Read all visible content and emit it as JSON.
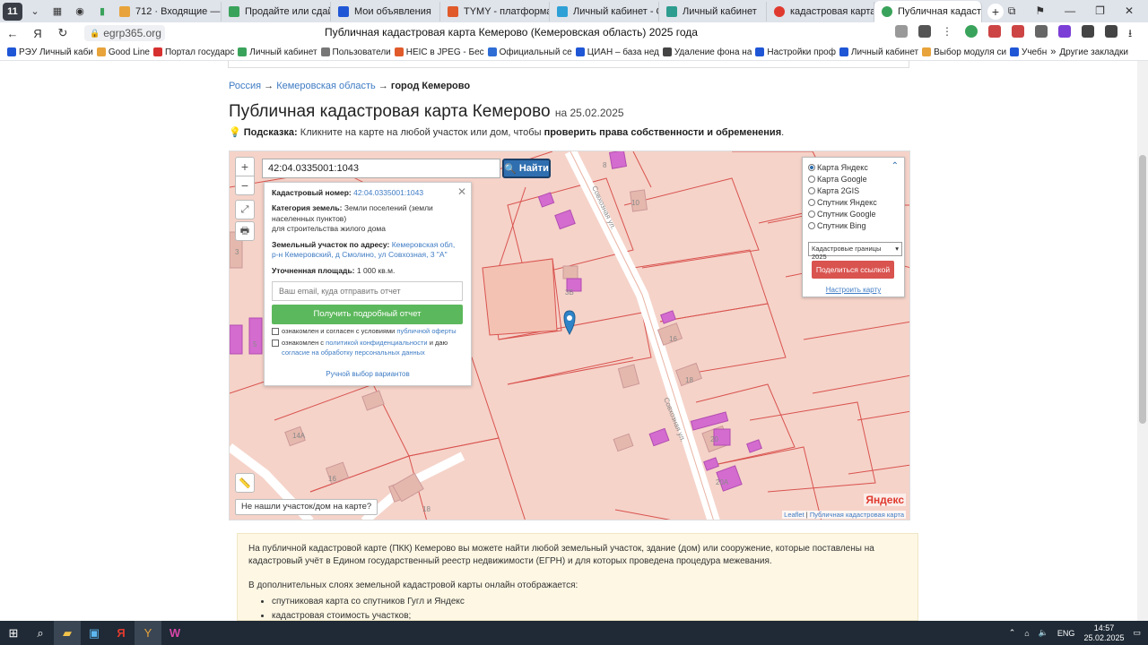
{
  "tabs": [
    {
      "label": "712 · Входящие — Янд",
      "color": "#e8a33a"
    },
    {
      "label": "Продайте или сдайте",
      "color": "#3aa35b"
    },
    {
      "label": "Мои объявления",
      "color": "#1f56d6"
    },
    {
      "label": "TYMY - платформа ре",
      "color": "#e05a2a"
    },
    {
      "label": "Личный кабинет - Об",
      "color": "#2ea0d6"
    },
    {
      "label": "Личный кабинет",
      "color": "#2e9c8e"
    },
    {
      "label": "кадастровая карта пу",
      "color": "#e03a2f"
    },
    {
      "label": "Публичная кадастрова",
      "color": "#3aa35b",
      "active": true
    }
  ],
  "tab_counter": "11",
  "address": {
    "url": "egrp365.org",
    "title": "Публичная кадастровая карта Кемерово (Кемеровская область) 2025 года"
  },
  "bookmarks": [
    {
      "label": "РЭУ Личный каби",
      "color": "#1f56d6"
    },
    {
      "label": "Good Line",
      "color": "#e8a33a"
    },
    {
      "label": "Портал государс",
      "color": "#d6312f"
    },
    {
      "label": "Личный кабинет",
      "color": "#3aa35b"
    },
    {
      "label": "Пользователи",
      "color": "#777777"
    },
    {
      "label": "HEIC в JPEG - Бес",
      "color": "#e05a2a"
    },
    {
      "label": "Официальный се",
      "color": "#2e6cd6"
    },
    {
      "label": "ЦИАН – база нед",
      "color": "#1f56d6"
    },
    {
      "label": "Удаление фона на",
      "color": "#444444"
    },
    {
      "label": "Настройки проф",
      "color": "#1f56d6"
    },
    {
      "label": "Личный кабинет",
      "color": "#1f56d6"
    },
    {
      "label": "Выбор модуля си",
      "color": "#e8a33a"
    },
    {
      "label": "Учебн",
      "color": "#1f56d6"
    }
  ],
  "bookmarks_more": "»",
  "bookmarks_other": "Другие закладки",
  "breadcrumb": {
    "item1": "Россия",
    "item2": "Кемеровская область",
    "current": "город Кемерово",
    "sep": "→"
  },
  "heading": {
    "title": "Публичная кадастровая карта Кемерово",
    "date": "на 25.02.2025"
  },
  "hint": {
    "label": "Подсказка:",
    "text": "Кликните на карте на любой участок или дом, чтобы",
    "bold": "проверить права собственности и обременения",
    "end": "."
  },
  "map": {
    "search_value": "42:04.0335001:1043",
    "find_label": "Найти",
    "popup": {
      "cad_label": "Кадастровый номер:",
      "cad_value": "42:04.0335001:1043",
      "cat_label": "Категория земель:",
      "cat_value": "Земли поселений (земли населенных пунктов)",
      "use_value": "для строительства жилого дома",
      "addr_label": "Земельный участок по адресу:",
      "addr_value": "Кемеровская обл, р-н Кемеровский, д Смолино, ул Совхозная, 3 \"А\"",
      "area_label": "Уточненная площадь:",
      "area_value": "1 000 кв.м.",
      "email_placeholder": "Ваш email, куда отправить отчет",
      "report_btn": "Получить подробный отчет",
      "agree1_text": "ознакомлен и согласен с условиями",
      "agree1_link": "публичной оферты",
      "agree2_text": "ознакомлен с",
      "agree2_link": "политикой конфиденциальности",
      "agree2_mid": "и даю",
      "agree2_link2": "согласие на обработку персональных данных",
      "manual_link": "Ручной выбор вариантов"
    },
    "layers": [
      "Карта Яндекс",
      "Карта Google",
      "Карта 2GIS",
      "Спутник Яндекс",
      "Спутник Google",
      "Спутник Bing"
    ],
    "layer_select": "Кадастровые границы 2025",
    "share_btn": "Поделиться ссылкой",
    "config_link": "Настроить карту",
    "not_found": "Не нашли участок/дом на карте?",
    "logo": "Яндекс",
    "attribution_leaflet": "Leaflet",
    "attribution_map": "Публичная кадастровая карта",
    "street_name": "Совхозная ул.",
    "labels": [
      "10",
      "3",
      "3Б",
      "16",
      "18",
      "14А",
      "16",
      "18",
      "20",
      "20А",
      "5",
      "8"
    ]
  },
  "info": {
    "p1": "На публичной кадастровой карте (ПКК) Кемерово вы можете найти любой земельный участок, здание (дом) или сооружение, которые поставлены на кадастровый учёт в Едином государственный реестр недвижимости (ЕГРН) и для которых проведена процедура межевания.",
    "p2": "В дополнительных слоях земельной кадастровой карты онлайн отображается:",
    "items": [
      "спутниковая карта со спутников Гугл и Яндекс",
      "кадастровая стоимость участков;"
    ]
  },
  "taskbar": {
    "lang": "ENG",
    "time": "14:57",
    "date": "25.02.2025"
  }
}
